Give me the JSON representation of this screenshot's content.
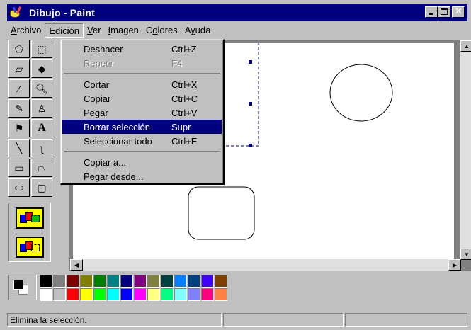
{
  "window": {
    "title": "Dibujo - Paint"
  },
  "menubar": {
    "items": [
      {
        "label": "Archivo",
        "key": "A"
      },
      {
        "label": "Edición",
        "key": "E"
      },
      {
        "label": "Ver",
        "key": "V"
      },
      {
        "label": "Imagen",
        "key": "I"
      },
      {
        "label": "Colores",
        "key": "o"
      },
      {
        "label": "Ayuda",
        "key": "y"
      }
    ]
  },
  "edit_menu": {
    "items": [
      {
        "label": "Deshacer",
        "shortcut": "Ctrl+Z",
        "state": "enabled"
      },
      {
        "label": "Repetir",
        "shortcut": "F4",
        "state": "disabled"
      },
      {
        "label": "Cortar",
        "shortcut": "Ctrl+X",
        "state": "enabled"
      },
      {
        "label": "Copiar",
        "shortcut": "Ctrl+C",
        "state": "enabled"
      },
      {
        "label": "Pegar",
        "shortcut": "Ctrl+V",
        "state": "enabled"
      },
      {
        "label": "Borrar selección",
        "shortcut": "Supr",
        "state": "highlighted"
      },
      {
        "label": "Seleccionar todo",
        "shortcut": "Ctrl+E",
        "state": "enabled"
      },
      {
        "label": "Copiar a...",
        "shortcut": "",
        "state": "enabled"
      },
      {
        "label": "Pegar desde...",
        "shortcut": "",
        "state": "enabled"
      }
    ]
  },
  "toolbox": {
    "tools": [
      {
        "name": "free-select-icon",
        "glyph": "⬠"
      },
      {
        "name": "rect-select-icon",
        "glyph": "⬚"
      },
      {
        "name": "eraser-icon",
        "glyph": "▱"
      },
      {
        "name": "fill-bucket-icon",
        "glyph": "◆"
      },
      {
        "name": "color-picker-icon",
        "glyph": "⁄"
      },
      {
        "name": "magnifier-icon",
        "glyph": "🔍︎"
      },
      {
        "name": "pencil-icon",
        "glyph": "✎"
      },
      {
        "name": "brush-icon",
        "glyph": "♙"
      },
      {
        "name": "airbrush-icon",
        "glyph": "⚑"
      },
      {
        "name": "text-icon",
        "glyph": "A"
      },
      {
        "name": "line-icon",
        "glyph": "╲"
      },
      {
        "name": "curve-icon",
        "glyph": "ʅ"
      },
      {
        "name": "rectangle-icon",
        "glyph": "▭"
      },
      {
        "name": "polygon-icon",
        "glyph": "⏢"
      },
      {
        "name": "ellipse-icon",
        "glyph": "⬭"
      },
      {
        "name": "rounded-rect-icon",
        "glyph": "▢"
      }
    ]
  },
  "palette": {
    "foreground": "#000000",
    "background": "#ffffff",
    "colors": [
      "#000000",
      "#808080",
      "#800000",
      "#808000",
      "#008000",
      "#008080",
      "#000080",
      "#800080",
      "#808040",
      "#004040",
      "#0080ff",
      "#004080",
      "#4000ff",
      "#804000",
      "#ffffff",
      "#c0c0c0",
      "#ff0000",
      "#ffff00",
      "#00ff00",
      "#00ffff",
      "#0000ff",
      "#ff00ff",
      "#ffff80",
      "#00ff80",
      "#80ffff",
      "#8080ff",
      "#ff0080",
      "#ff8040"
    ]
  },
  "statusbar": {
    "message": "Elimina la selección."
  }
}
